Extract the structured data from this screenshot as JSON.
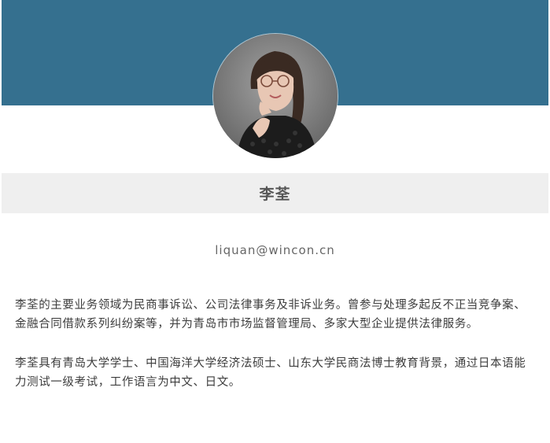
{
  "profile": {
    "name": "李荃",
    "email": "liquan@wincon.cn",
    "avatar_icon": "portrait-photo",
    "bio": [
      "李荃的主要业务领域为民商事诉讼、公司法律事务及非诉业务。曾参与处理多起反不正当竞争案、金融合同借款系列纠纷案等，并为青岛市市场监督管理局、多家大型企业提供法律服务。",
      "李荃具有青岛大学学士、中国海洋大学经济法硕士、山东大学民商法博士教育背景，通过日本语能力测试一级考试，工作语言为中文、日文。"
    ]
  },
  "colors": {
    "banner": "#35708f",
    "name_bar": "#efefef",
    "name_text": "#555555",
    "body_text": "#3d3d3d"
  }
}
